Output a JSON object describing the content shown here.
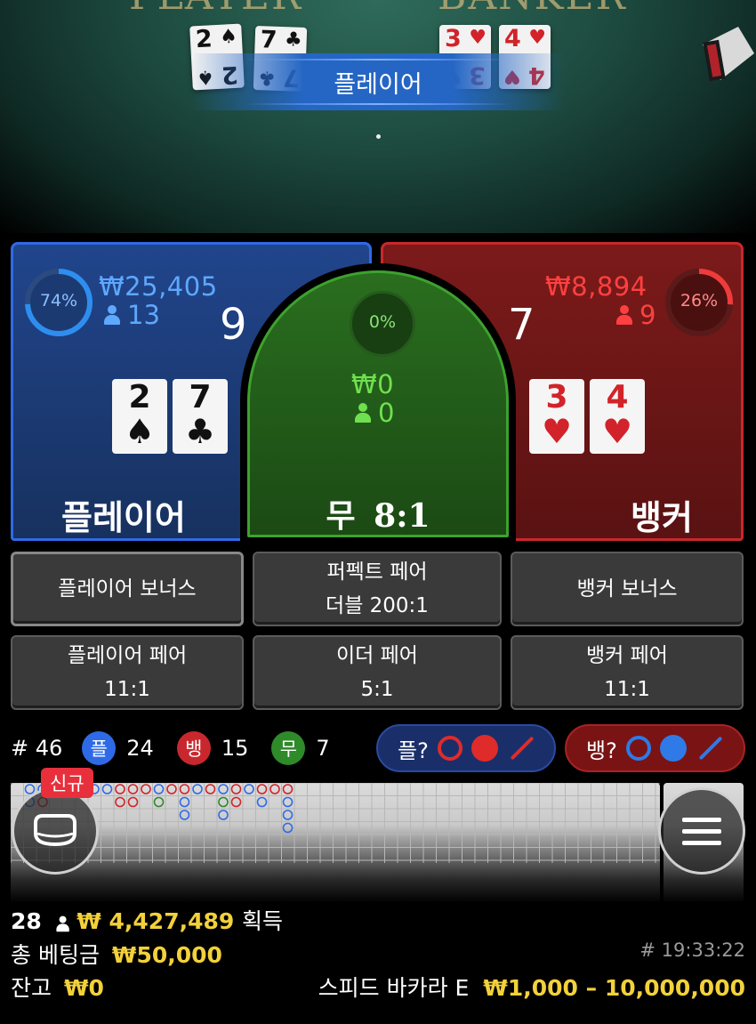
{
  "table": {
    "player_word": "PLAYER",
    "banker_word": "BANKER",
    "result_banner": "플레이어",
    "player_cards": [
      {
        "rank": "2",
        "suit": "♠"
      },
      {
        "rank": "7",
        "suit": "♣"
      }
    ],
    "banker_cards": [
      {
        "rank": "3",
        "suit": "♥"
      },
      {
        "rank": "4",
        "suit": "♥"
      }
    ]
  },
  "player": {
    "percent_label": "74%",
    "percent": 74,
    "amount": "₩25,405",
    "players": "13",
    "score": "9",
    "title": "플레이어",
    "cards": [
      {
        "rank": "2",
        "suit": "♠"
      },
      {
        "rank": "7",
        "suit": "♣"
      }
    ]
  },
  "tie": {
    "percent_label": "0%",
    "amount": "₩0",
    "players": "0",
    "title": "무",
    "payout": "8:1"
  },
  "banker": {
    "percent_label": "26%",
    "percent": 26,
    "amount": "₩8,894",
    "players": "9",
    "score": "7",
    "title": "뱅커",
    "cards": [
      {
        "rank": "3",
        "suit": "♥"
      },
      {
        "rank": "4",
        "suit": "♥"
      }
    ]
  },
  "side_bets": {
    "player_bonus": "플레이어 보너스",
    "perfect_pair": {
      "line1": "퍼펙트 페어",
      "line2": "더블 200:1"
    },
    "banker_bonus": "뱅커 보너스",
    "player_pair": {
      "line1": "플레이어 페어",
      "line2": "11:1"
    },
    "either_pair": {
      "line1": "이더 페어",
      "line2": "5:1"
    },
    "banker_pair": {
      "line1": "뱅커 페어",
      "line2": "11:1"
    }
  },
  "stats": {
    "round": "# 46",
    "player_icon": "플",
    "player_count": "24",
    "banker_icon": "뱅",
    "banker_count": "15",
    "tie_icon": "무",
    "tie_count": "7"
  },
  "predict": {
    "player_label": "플?",
    "banker_label": "뱅?"
  },
  "road": {
    "new_badge": "신규"
  },
  "footer": {
    "winners": "28",
    "win_amount": "₩ 4,427,489",
    "win_label": "획득",
    "total_bet_label": "총 베팅금",
    "total_bet": "₩50,000",
    "balance_label": "잔고",
    "balance": "₩0",
    "game_id": "# 19:33:22",
    "table_name": "스피드 바카라 E",
    "limits": "₩1,000 – 10,000,000"
  },
  "colors": {
    "player": "#2f6ae6",
    "banker": "#c8282d",
    "tie": "#3da22e",
    "gold": "#f2d13a"
  },
  "icons": {
    "lobby": "table-icon",
    "menu": "hamburger-menu-icon",
    "user": "person-icon"
  }
}
